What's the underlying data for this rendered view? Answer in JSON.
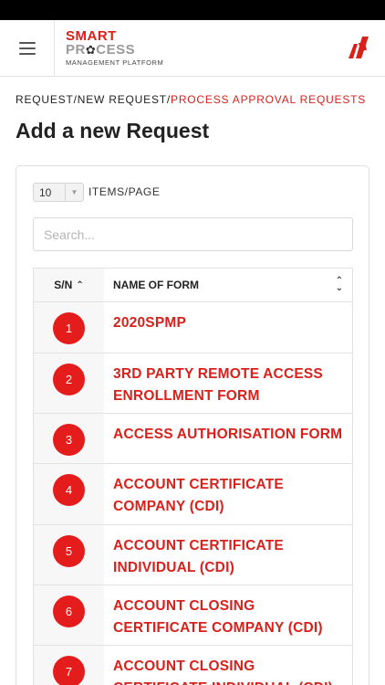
{
  "header": {
    "brand_line1": "SMART",
    "brand_line2_a": "PR",
    "brand_line2_b": "CESS",
    "brand_line3": "MANAGEMENT PLATFORM",
    "accent_color": "#d9211c"
  },
  "breadcrumb": {
    "part1": "REQUEST/",
    "part2": "NEW REQUEST/",
    "current": "PROCESS APPROVAL REQUESTS"
  },
  "page": {
    "title": "Add a new Request"
  },
  "controls": {
    "page_size": "10",
    "page_size_label": "ITEMS/PAGE",
    "search_placeholder": "Search..."
  },
  "table": {
    "col_sn": "S/N",
    "col_name": "NAME OF FORM",
    "rows": [
      {
        "sn": "1",
        "name": "2020SPMP"
      },
      {
        "sn": "2",
        "name": "3RD PARTY REMOTE ACCESS ENROLLMENT FORM"
      },
      {
        "sn": "3",
        "name": "ACCESS AUTHORISATION FORM"
      },
      {
        "sn": "4",
        "name": "ACCOUNT CERTIFICATE COMPANY (CDI)"
      },
      {
        "sn": "5",
        "name": "ACCOUNT CERTIFICATE INDIVIDUAL (CDI)"
      },
      {
        "sn": "6",
        "name": "ACCOUNT CLOSING CERTIFICATE COMPANY (CDI)"
      },
      {
        "sn": "7",
        "name": "ACCOUNT CLOSING CERTIFICATE INDIVIDUAL (CDI)"
      }
    ]
  }
}
